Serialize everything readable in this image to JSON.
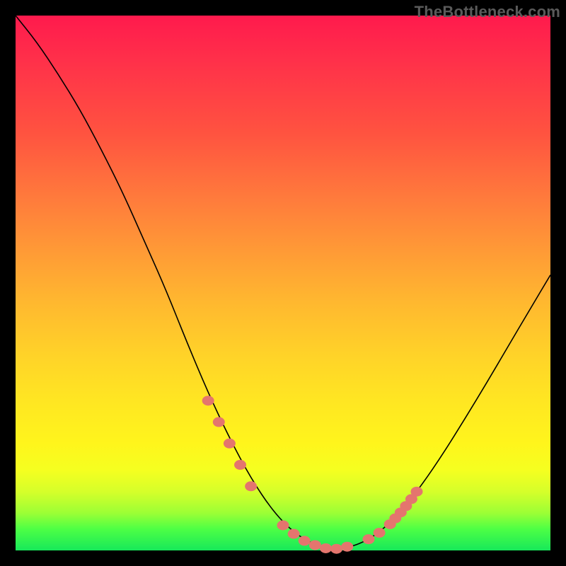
{
  "watermark": "TheBottleneck.com",
  "colors": {
    "background": "#000000",
    "gradient_top": "#ff1a4d",
    "gradient_bottom": "#17e85a",
    "curve": "#000000",
    "marker": "#e4756e"
  },
  "chart_data": {
    "type": "line",
    "title": "",
    "xlabel": "",
    "ylabel": "",
    "xlim": [
      0,
      100
    ],
    "ylim": [
      0,
      100
    ],
    "grid": false,
    "legend": false,
    "curve": {
      "x": [
        0,
        4,
        8,
        12,
        16,
        20,
        24,
        28,
        32,
        36,
        40,
        44,
        48,
        52,
        56,
        60,
        64,
        68,
        72,
        76,
        80,
        84,
        88,
        92,
        96,
        100
      ],
      "y": [
        100,
        95,
        89,
        82.5,
        75,
        67,
        58,
        49,
        39,
        29.5,
        21,
        13.5,
        7.5,
        3.3,
        1.0,
        0.2,
        1.0,
        3.3,
        7.2,
        12.3,
        18.2,
        24.6,
        31.2,
        38.0,
        44.8,
        51.5
      ]
    },
    "markers": {
      "x": [
        36,
        38,
        40,
        42,
        44,
        50,
        52,
        54,
        56,
        58,
        60,
        62,
        66,
        68,
        70,
        71,
        72,
        73,
        74,
        75
      ],
      "y": [
        28,
        24,
        20,
        16,
        12,
        4.7,
        3.1,
        1.8,
        1.0,
        0.4,
        0.3,
        0.7,
        2.1,
        3.3,
        4.9,
        6.0,
        7.1,
        8.3,
        9.6,
        11.0
      ]
    }
  }
}
